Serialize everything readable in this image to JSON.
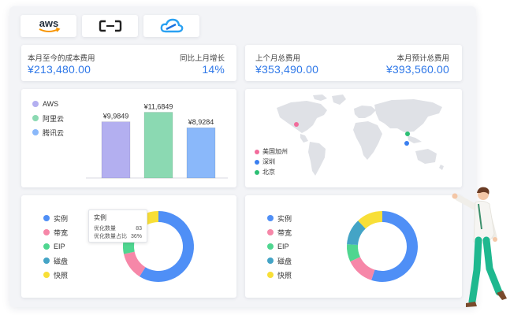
{
  "providers": [
    {
      "name": "aws",
      "label": "aws"
    },
    {
      "name": "aliyun"
    },
    {
      "name": "tencent-cloud"
    }
  ],
  "metrics": {
    "mtd_cost_label": "本月至今的成本费用",
    "mtd_cost_value": "¥213,480.00",
    "mom_growth_label": "同比上月增长",
    "mom_growth_value": "14%",
    "last_month_label": "上个月总费用",
    "last_month_value": "¥353,490.00",
    "forecast_label": "本月预计总费用",
    "forecast_value": "¥393,560.00"
  },
  "bar_chart": {
    "legend": [
      "AWS",
      "阿里云",
      "腾讯云"
    ]
  },
  "chart_data": [
    {
      "type": "bar",
      "categories": [
        "AWS",
        "阿里云",
        "腾讯云"
      ],
      "values": [
        9984.9,
        11684.9,
        8928.4
      ],
      "data_labels": [
        "¥9,9849",
        "¥11,6849",
        "¥8,9284"
      ],
      "colors": [
        "#b3aff0",
        "#8bd9b2",
        "#8ab8fa"
      ],
      "ylim": [
        0,
        14000
      ]
    },
    {
      "type": "pie",
      "labels": [
        "实例",
        "带宽",
        "EIP",
        "磁盘",
        "快照"
      ],
      "values": [
        56,
        12,
        10,
        10,
        7
      ],
      "colors": [
        "#4f8ff6",
        "#f687a8",
        "#4fd690",
        "#44a4c6",
        "#f8df37"
      ]
    },
    {
      "type": "pie",
      "labels": [
        "实例",
        "带宽",
        "EIP",
        "磁盘",
        "快照"
      ],
      "values": [
        55,
        13,
        8,
        12,
        12
      ],
      "colors": [
        "#4f8ff6",
        "#f687a8",
        "#4fd690",
        "#44a4c6",
        "#f8df37"
      ]
    }
  ],
  "map": {
    "legend": [
      {
        "label": "美国加州",
        "color": "#f26b9b"
      },
      {
        "label": "深圳",
        "color": "#3a7ff0"
      },
      {
        "label": "北京",
        "color": "#2cbf74"
      }
    ]
  },
  "donut_left": {
    "legend": [
      {
        "label": "实例",
        "color": "#4f8ff6"
      },
      {
        "label": "带宽",
        "color": "#f687a8"
      },
      {
        "label": "EIP",
        "color": "#4fd690"
      },
      {
        "label": "磁盘",
        "color": "#44a4c6"
      },
      {
        "label": "快照",
        "color": "#f8df37"
      }
    ],
    "tooltip": {
      "title": "实例",
      "row1_label": "优化数量",
      "row1_value": "83",
      "row2_label": "优化数量占比",
      "row2_value": "36%"
    }
  },
  "donut_right": {
    "legend": [
      {
        "label": "实例",
        "color": "#4f8ff6"
      },
      {
        "label": "带宽",
        "color": "#f687a8"
      },
      {
        "label": "EIP",
        "color": "#4fd690"
      },
      {
        "label": "磁盘",
        "color": "#44a4c6"
      },
      {
        "label": "快照",
        "color": "#f8df37"
      }
    ]
  }
}
